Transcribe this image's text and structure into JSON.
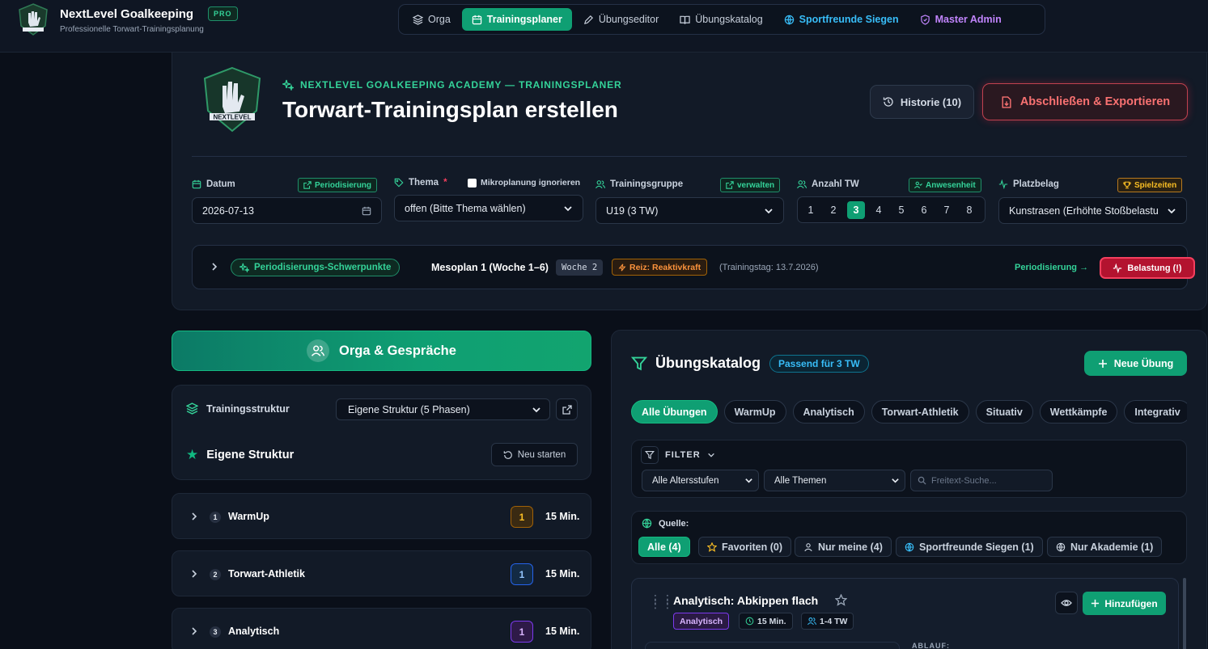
{
  "app": {
    "name": "NextLevel Goalkeeping",
    "badge": "PRO",
    "tagline": "Professionelle Torwart-Trainingsplanung",
    "logo_text": "NEXTLEVEL"
  },
  "nav": {
    "items": [
      {
        "label": "Orga",
        "icon": "layers-icon"
      },
      {
        "label": "Trainingsplaner",
        "icon": "calendar-icon",
        "active": true
      },
      {
        "label": "Übungseditor",
        "icon": "pen-icon"
      },
      {
        "label": "Übungskatalog",
        "icon": "book-icon"
      },
      {
        "label": "Sportfreunde Siegen",
        "icon": "globe-icon"
      },
      {
        "label": "Master Admin",
        "icon": "shield-icon"
      }
    ]
  },
  "header": {
    "eyebrow": "NEXTLEVEL GOALKEEPING ACADEMY — TRAININGSPLANER",
    "title": "Torwart-Trainingsplan erstellen",
    "history_label": "Historie (10)",
    "export_label": "Abschließen & Exportieren"
  },
  "form": {
    "datum_label": "Datum",
    "datum_link": "Periodisierung",
    "datum_value": "2026-07-13",
    "thema_label": "Thema",
    "thema_required": "*",
    "mikro_label": "Mikroplanung ignorieren",
    "thema_value": "offen (Bitte Thema wählen)",
    "gruppe_label": "Trainingsgruppe",
    "gruppe_link": "verwalten",
    "gruppe_value": "U19 (3 TW)",
    "anzahl_label": "Anzahl TW",
    "anzahl_link": "Anwesenheit",
    "anzahl_options": [
      "1",
      "2",
      "3",
      "4",
      "5",
      "6",
      "7",
      "8"
    ],
    "anzahl_selected": 3,
    "platz_label": "Platzbelag",
    "platz_link": "Spielzeiten",
    "platz_value": "Kunstrasen (Erhöhte Stoßbelastu"
  },
  "periodisierung": {
    "chip": "Periodisierungs-Schwerpunkte",
    "mesoplan": "Mesoplan 1 (Woche 1–6)",
    "woche": "Woche 2",
    "reiz": "Reiz: Reaktivkraft",
    "trainingstag": "(Trainingstag: 13.7.2026)",
    "link": "Periodisierung →",
    "belastung": "Belastung (!)"
  },
  "orga": {
    "button_label": "Orga & Gespräche"
  },
  "struktur": {
    "label": "Trainingsstruktur",
    "select_value": "Eigene Struktur (5 Phasen)",
    "title": "Eigene Struktur",
    "restart_label": "Neu starten",
    "phases": [
      {
        "num": "1",
        "name": "WarmUp",
        "count": "1",
        "minutes": "15 Min."
      },
      {
        "num": "2",
        "name": "Torwart-Athletik",
        "count": "1",
        "minutes": "15 Min."
      },
      {
        "num": "3",
        "name": "Analytisch",
        "count": "1",
        "minutes": "15 Min."
      }
    ]
  },
  "katalog": {
    "title": "Übungskatalog",
    "passend": "Passend für 3 TW",
    "new_label": "Neue Übung",
    "tabs": [
      "Alle Übungen",
      "WarmUp",
      "Analytisch",
      "Torwart-Athletik",
      "Situativ",
      "Wettkämpfe",
      "Integrativ"
    ],
    "filter_label": "FILTER",
    "alter_value": "Alle Altersstufen",
    "themen_value": "Alle Themen",
    "search_placeholder": "Freitext-Suche...",
    "quelle_label": "Quelle:",
    "quellen": [
      {
        "label": "Alle (4)",
        "icon": "",
        "active": true
      },
      {
        "label": "Favoriten (0)",
        "icon": "star-icon"
      },
      {
        "label": "Nur meine (4)",
        "icon": "user-icon"
      },
      {
        "label": "Sportfreunde Siegen (1)",
        "icon": "globe-icon"
      },
      {
        "label": "Nur Akademie (1)",
        "icon": "globe-icon"
      }
    ],
    "exercise": {
      "title": "Analytisch: Abkippen flach",
      "category": "Analytisch",
      "duration": "15 Min.",
      "players": "1-4 TW",
      "add_label": "Hinzufügen",
      "ablauf": "ABLAUF:"
    }
  },
  "colors": {
    "accent": "#0f9f73",
    "danger": "#f43f5e",
    "info": "#38bdf8"
  }
}
